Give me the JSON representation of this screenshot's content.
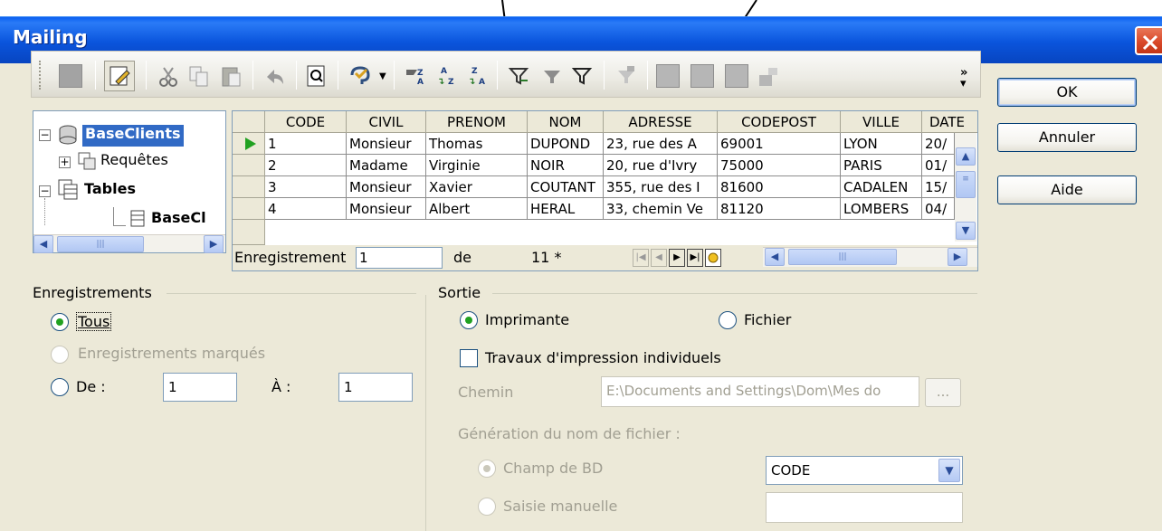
{
  "window": {
    "title": "Mailing"
  },
  "tree": {
    "root": "BaseClients",
    "queries": "Requêtes",
    "tables": "Tables",
    "table_item": "BaseCl"
  },
  "grid": {
    "columns": [
      "CODE",
      "CIVIL",
      "PRENOM",
      "NOM",
      "ADRESSE",
      "CODEPOST",
      "VILLE",
      "DATE"
    ],
    "rows": [
      [
        "1",
        "Monsieur",
        "Thomas",
        "DUPOND",
        "23, rue des A",
        "69001",
        "LYON",
        "20/"
      ],
      [
        "2",
        "Madame",
        "Virginie",
        "NOIR",
        "20, rue d'Ivry",
        "75000",
        "PARIS",
        "01/"
      ],
      [
        "3",
        "Monsieur",
        "Xavier",
        "COUTANT",
        "355, rue des I",
        "81600",
        "CADALEN",
        "15/"
      ],
      [
        "4",
        "Monsieur",
        "Albert",
        "HERAL",
        "33, chemin Ve",
        "81120",
        "LOMBERS",
        "04/"
      ]
    ],
    "nav": {
      "label": "Enregistrement",
      "value": "1",
      "of": "de",
      "total": "11 *"
    }
  },
  "buttons": {
    "ok": "OK",
    "cancel": "Annuler",
    "help": "Aide"
  },
  "records": {
    "group_label": "Enregistrements",
    "all": "Tous",
    "marked": "Enregistrements marqués",
    "from": "De :",
    "from_value": "1",
    "to": "À :",
    "to_value": "1"
  },
  "output": {
    "group_label": "Sortie",
    "printer": "Imprimante",
    "file": "Fichier",
    "individual_jobs": "Travaux d'impression individuels",
    "path_label": "Chemin",
    "path_value": "E:\\Documents and Settings\\Dom\\Mes do",
    "browse": "...",
    "filename_gen": "Génération du nom de fichier :",
    "db_field": "Champ de BD",
    "db_field_value": "CODE",
    "manual": "Saisie manuelle",
    "manual_value": ""
  }
}
